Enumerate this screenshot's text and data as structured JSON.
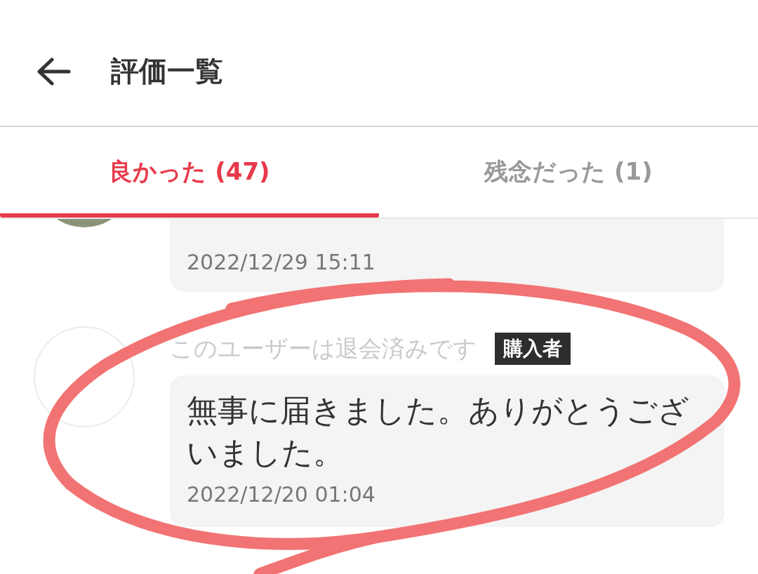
{
  "header": {
    "title": "評価一覧"
  },
  "tabs": [
    {
      "label": "良かった (47)",
      "selected": true
    },
    {
      "label": "残念だった (1)",
      "selected": false
    }
  ],
  "reviews": [
    {
      "date": "2022/12/29 15:11"
    },
    {
      "avatar": {
        "kind": "blank"
      },
      "name": "このユーザーは退会済みです",
      "badge": "購入者",
      "message": "無事に届きました。ありがとうございました。",
      "date": "2022/12/20 01:04"
    }
  ]
}
